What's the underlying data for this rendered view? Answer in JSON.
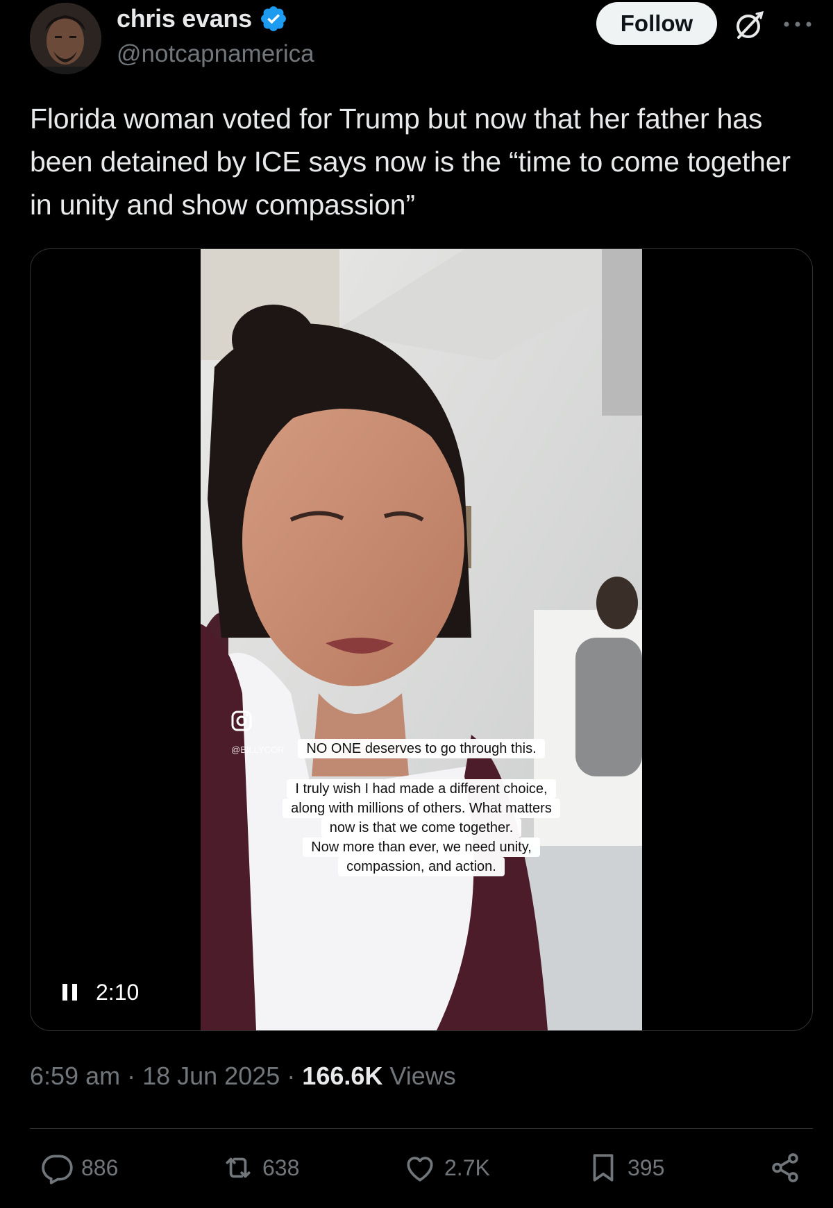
{
  "post": {
    "author": {
      "display_name": "chris evans",
      "handle": "@notcapnamerica",
      "verified": true
    },
    "follow_label": "Follow",
    "text": "Florida woman voted for Trump but now that her father has been detained by ICE says now is the “time to come together in unity and show compassion”",
    "video": {
      "duration": "2:10",
      "watermark": "@BILLYCOR",
      "caption_line_1": "NO ONE deserves to go through this.",
      "caption_lines_2": [
        "I truly wish I had made a different choice,",
        "along with millions of others. What matters",
        "now is that we come together.",
        "Now more than ever, we need unity,",
        "compassion, and action."
      ]
    },
    "time": "6:59 am",
    "date": "18 Jun 2025",
    "views_count": "166.6K",
    "views_label": "Views",
    "stats": {
      "replies": "886",
      "reposts": "638",
      "likes": "2.7K",
      "bookmarks": "395"
    }
  },
  "colors": {
    "background": "#000000",
    "text_primary": "#e7e9ea",
    "text_secondary": "#71767b",
    "verified_blue": "#1d9bf0",
    "follow_button_bg": "#eff3f4"
  }
}
